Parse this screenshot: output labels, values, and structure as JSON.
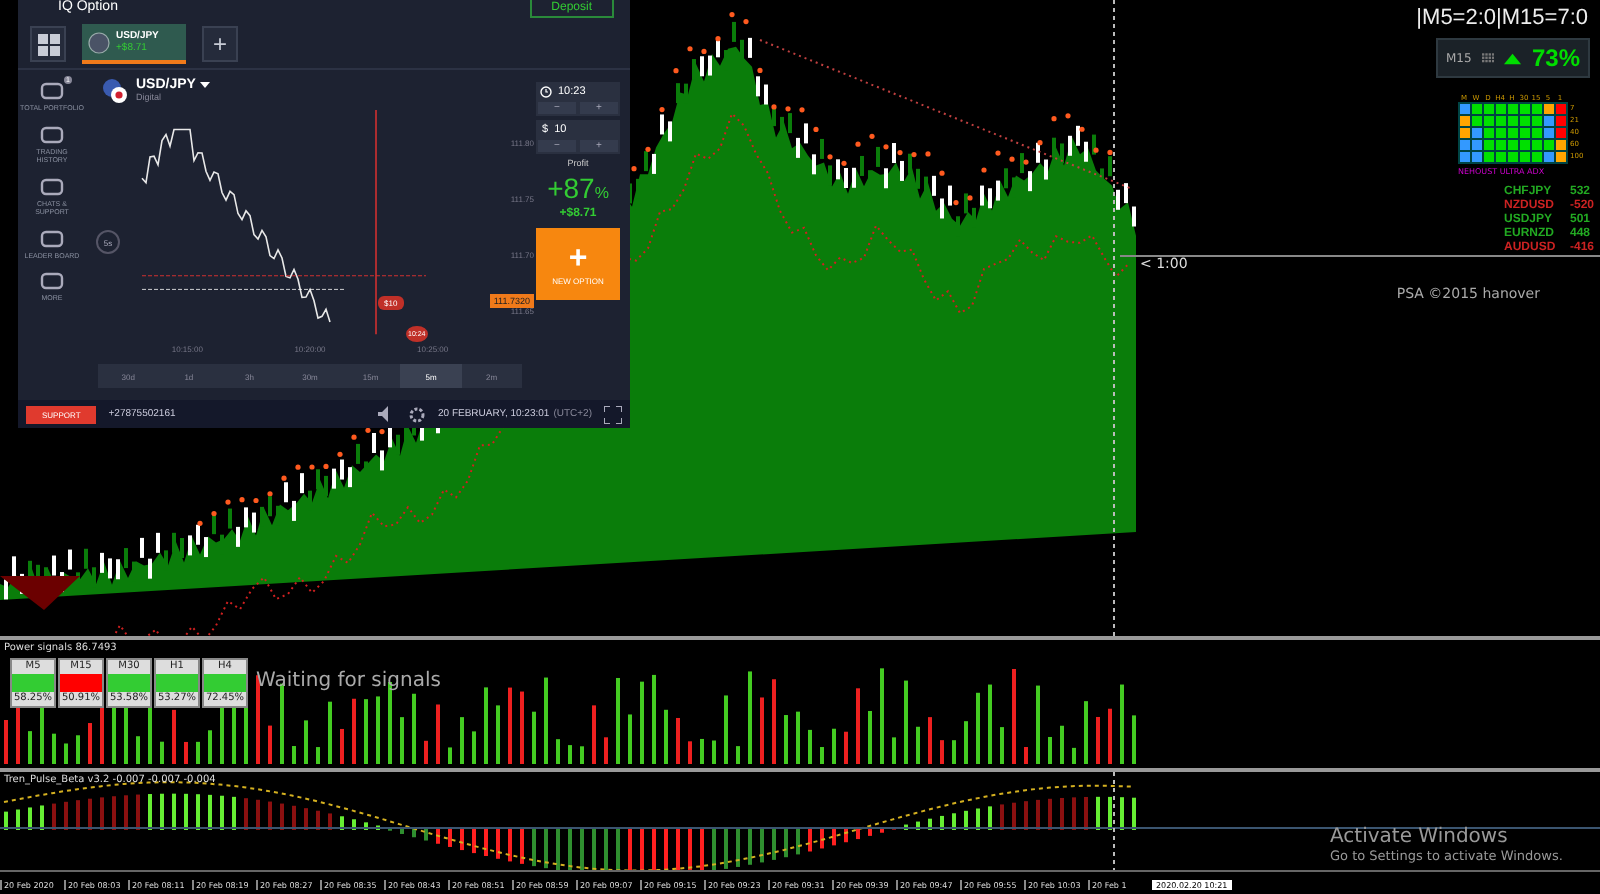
{
  "iq_window": {
    "logo": "IQ Option",
    "deposit": "Deposit",
    "asset_tab": {
      "pair": "USD/JPY",
      "profit": "+$8.71",
      "selected": true
    },
    "sidebar": [
      {
        "label": "TOTAL PORTFOLIO",
        "badge": "1"
      },
      {
        "label": "TRADING HISTORY"
      },
      {
        "label": "CHATS & SUPPORT"
      },
      {
        "label": "LEADER BOARD"
      },
      {
        "label": "MORE"
      }
    ],
    "asset": {
      "name": "USD/JPY",
      "type": "Digital"
    },
    "price_ticks": [
      "111.80",
      "111.75",
      "111.70",
      "111.65"
    ],
    "time_ticks": [
      "10:15:00",
      "10:20:00",
      "10:25:00"
    ],
    "tools": [
      "5s"
    ],
    "invest_tag": "$10",
    "price_tag": "111.7320",
    "timer_tag": "10:24",
    "periods": [
      {
        "label": "30d",
        "selected": false
      },
      {
        "label": "1d",
        "selected": false
      },
      {
        "label": "3h",
        "selected": false
      },
      {
        "label": "30m",
        "selected": false
      },
      {
        "label": "15m",
        "selected": false
      },
      {
        "label": "5m",
        "selected": true
      },
      {
        "label": "2m",
        "selected": false
      }
    ],
    "expiry": "10:23",
    "amount": "10",
    "currency": "$",
    "minus": "−",
    "plus": "+",
    "profit_label": "Profit",
    "profit_percent": "+87",
    "percent_sign": "%",
    "profit_amount": "+$8.71",
    "new_option": "NEW OPTION",
    "footer": {
      "support": "SUPPORT",
      "phone": "+27875502161",
      "datetime": "20 FEBRUARY, 10:23:01",
      "timezone": "(UTC+2)"
    }
  },
  "status": "|M5=2:0|M15=7:0",
  "signal_box": {
    "label": "M15",
    "percent": "73%"
  },
  "heatmap": {
    "columns": [
      "M",
      "W",
      "D",
      "H4",
      "H",
      "30",
      "15",
      "5",
      "1"
    ],
    "rows": [
      {
        "label": "7",
        "cells": [
          {
            "color": "#3399ff"
          },
          {
            "color": "#00e000"
          },
          {
            "color": "#00e000"
          },
          {
            "color": "#00e000"
          },
          {
            "color": "#00e000"
          },
          {
            "color": "#00e000"
          },
          {
            "color": "#00e000"
          },
          {
            "color": "#ffa500"
          },
          {
            "color": "#ff0000"
          }
        ]
      },
      {
        "label": "21",
        "cells": [
          {
            "color": "#ffa500"
          },
          {
            "color": "#00e000"
          },
          {
            "color": "#00e000"
          },
          {
            "color": "#00e000"
          },
          {
            "color": "#00e000"
          },
          {
            "color": "#00e000"
          },
          {
            "color": "#00e000"
          },
          {
            "color": "#3399ff"
          },
          {
            "color": "#ff0000"
          }
        ]
      },
      {
        "label": "40",
        "cells": [
          {
            "color": "#ffa500"
          },
          {
            "color": "#3399ff"
          },
          {
            "color": "#00e000"
          },
          {
            "color": "#00e000"
          },
          {
            "color": "#00e000"
          },
          {
            "color": "#00e000"
          },
          {
            "color": "#00e000"
          },
          {
            "color": "#3399ff"
          },
          {
            "color": "#ff0000"
          }
        ]
      },
      {
        "label": "60",
        "cells": [
          {
            "color": "#3399ff"
          },
          {
            "color": "#3399ff"
          },
          {
            "color": "#00e000"
          },
          {
            "color": "#00e000"
          },
          {
            "color": "#00e000"
          },
          {
            "color": "#00e000"
          },
          {
            "color": "#00e000"
          },
          {
            "color": "#00e000"
          },
          {
            "color": "#ffa500"
          }
        ]
      },
      {
        "label": "100",
        "cells": [
          {
            "color": "#3399ff"
          },
          {
            "color": "#3399ff"
          },
          {
            "color": "#00e000"
          },
          {
            "color": "#00e000"
          },
          {
            "color": "#00e000"
          },
          {
            "color": "#00e000"
          },
          {
            "color": "#00e000"
          },
          {
            "color": "#3399ff"
          },
          {
            "color": "#ffa500"
          }
        ]
      }
    ],
    "legend": "NEHOUST ULTRA ADX"
  },
  "pairs": [
    {
      "name": "CHFJPY",
      "value": "532",
      "color": "#22aa22"
    },
    {
      "name": "NZDUSD",
      "value": "-520",
      "color": "#cc2222"
    },
    {
      "name": "USDJPY",
      "value": "501",
      "color": "#22aa22"
    },
    {
      "name": "EURNZD",
      "value": "448",
      "color": "#22aa22"
    },
    {
      "name": "AUDUSD",
      "value": "-416",
      "color": "#cc2222"
    }
  ],
  "countdown": "< 1:00",
  "credit": "PSA ©2015 hanover",
  "power_pane": {
    "title": "Power signals 86.7493",
    "message": "Waiting for signals",
    "timeframes": [
      {
        "label": "M5",
        "color": "#33cc33",
        "value": "58.25%"
      },
      {
        "label": "M15",
        "color": "#ff0000",
        "value": "50.91%"
      },
      {
        "label": "M30",
        "color": "#33cc33",
        "value": "53.58%"
      },
      {
        "label": "H1",
        "color": "#33cc33",
        "value": "53.27%"
      },
      {
        "label": "H4",
        "color": "#33cc33",
        "value": "72.45%"
      }
    ]
  },
  "trend_pane": {
    "title": "Tren_Pulse_Beta v3.2 -0.007 -0.007 -0.004"
  },
  "time_axis": {
    "labels": [
      "20 Feb 2020",
      "20 Feb 08:03",
      "20 Feb 08:11",
      "20 Feb 08:19",
      "20 Feb 08:27",
      "20 Feb 08:35",
      "20 Feb 08:43",
      "20 Feb 08:51",
      "20 Feb 08:59",
      "20 Feb 09:07",
      "20 Feb 09:15",
      "20 Feb 09:23",
      "20 Feb 09:31",
      "20 Feb 09:39",
      "20 Feb 09:47",
      "20 Feb 09:55",
      "20 Feb 10:03",
      "20 Feb 1"
    ],
    "current": "2020.02.20 10:21"
  },
  "activation": {
    "title": "Activate Windows",
    "hint": "Go to Settings to activate Windows."
  }
}
